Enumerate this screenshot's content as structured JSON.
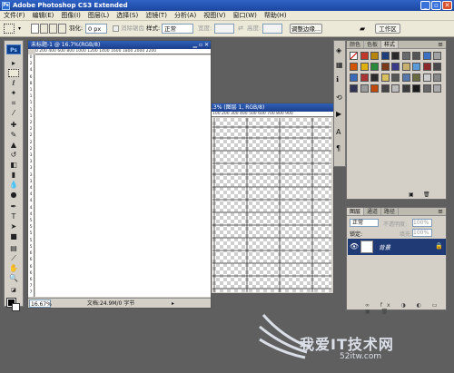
{
  "app": {
    "title": "Adobe Photoshop CS3 Extended",
    "logo": "Ps"
  },
  "menu": [
    "文件(F)",
    "编辑(E)",
    "图像(I)",
    "图层(L)",
    "选择(S)",
    "滤镜(T)",
    "分析(A)",
    "视图(V)",
    "窗口(W)",
    "帮助(H)"
  ],
  "options": {
    "feather_label": "羽化:",
    "feather_value": "0 px",
    "antialias_label": "消除锯齿",
    "style_label": "样式:",
    "style_value": "正常",
    "width_label": "宽度:",
    "height_label": "高度:",
    "refine_edge": "调整边缘...",
    "workspace": "工作区"
  },
  "doc1": {
    "title": "未标题-1 @ 16.7%(RGB/8)",
    "ruler_h": "0    200   400   600   800   1000  1200  1400  1600  1800  2000  2200",
    "ruler_v": [
      "0",
      "2",
      "4",
      "6",
      "8",
      "1",
      "1",
      "1",
      "1",
      "1",
      "2",
      "2",
      "2",
      "2",
      "2",
      "3",
      "3",
      "3",
      "3",
      "3",
      "4",
      "4",
      "4",
      "4",
      "4",
      "5",
      "5",
      "5",
      "5",
      "5",
      "6",
      "6",
      "6",
      "6",
      "6",
      "7",
      "7"
    ],
    "zoom": "16.67%",
    "doc_info": "文档:24.9M/0 字节"
  },
  "doc2": {
    "title": ".3% (图层 1, RGB/8)",
    "ruler_h": "100  200  300  400  500  600  700  800  900"
  },
  "styles_panel": {
    "tabs": [
      "颜色",
      "色板",
      "样式"
    ],
    "swatch_colors": [
      "#ffffff",
      "#c0392b",
      "#b8860b",
      "#1e3f7a",
      "#2a2a2a",
      "#6a6a6a",
      "#555555",
      "#3d6fc2",
      "#a0a0a0",
      "#d35400",
      "#e0b010",
      "#2a8a3a",
      "#7a3a1a",
      "#3a3a8a",
      "#c8b070",
      "#5a9ad8",
      "#8a2a2a",
      "#4a4a4a",
      "#3a6ab8",
      "#a33",
      "#2b2b2b",
      "#d8c060",
      "#555",
      "#5577aa",
      "#6a6a40",
      "#ccc",
      "#888",
      "#335",
      "#9a9a9a",
      "#c04a0a",
      "#444",
      "#bbb",
      "#3a3a3a",
      "#1a1a1a",
      "#666",
      "#aaa"
    ]
  },
  "layers_panel": {
    "tabs": [
      "图层",
      "通道",
      "路径"
    ],
    "blend_mode": "正常",
    "opacity_label": "不透明度:",
    "opacity_value": "100%",
    "lock_label": "锁定:",
    "fill_label": "填充:",
    "fill_value": "100%",
    "layer_name": "背景"
  },
  "watermark": {
    "text": "我爱IT技术网",
    "url": "52itw.com"
  }
}
